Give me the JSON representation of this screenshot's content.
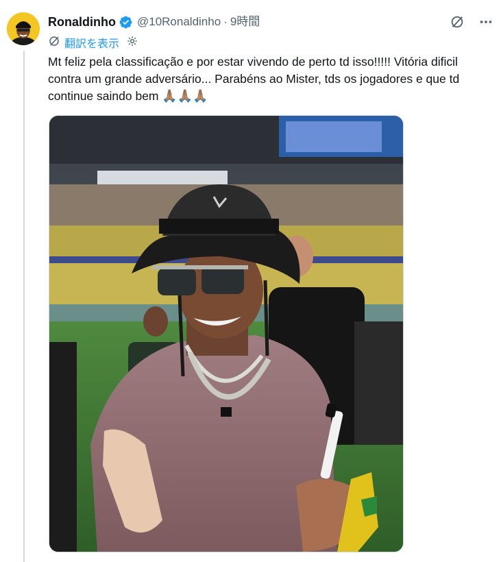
{
  "tweet": {
    "author_name": "Ronaldinho",
    "handle": "@10Ronaldinho",
    "separator": "·",
    "time": "9時間",
    "translate_label": "翻訳を表示",
    "text": "Mt feliz pela classificação e por estar vivendo de perto td isso!!!!! Vitória dificil contra um grande adversário... Parabéns ao Mister, tds os jogadores e que td continue saindo bem ",
    "emojis": "🙏🏽🙏🏽🙏🏽"
  },
  "icons": {
    "verified": "verified-badge-icon",
    "grok": "grok-icon",
    "more": "more-icon",
    "translate": "translate-icon",
    "settings": "gear-icon"
  },
  "colors": {
    "accent": "#1d9bf0",
    "secondary_text": "#536471",
    "thread_line": "#cfd9de"
  }
}
